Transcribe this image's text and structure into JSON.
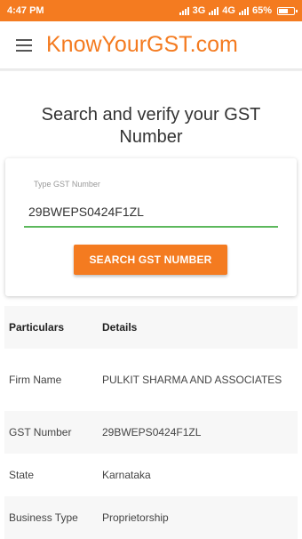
{
  "status_bar": {
    "time": "4:47 PM",
    "network_1": "3G",
    "network_2": "4G",
    "battery": "65%",
    "battery_level": 0.65
  },
  "app_bar": {
    "title": "KnowYourGST.com"
  },
  "heading": "Search and verify your GST Number",
  "search": {
    "label": "Type GST Number",
    "value": "29BWEPS0424F1ZL",
    "button_label": "SEARCH GST NUMBER"
  },
  "details": {
    "header": {
      "particulars": "Particulars",
      "details": "Details"
    },
    "rows": [
      {
        "label": "Firm Name",
        "value": "PULKIT SHARMA AND ASSOCIATES"
      },
      {
        "label": "GST Number",
        "value": "29BWEPS0424F1ZL"
      },
      {
        "label": "State",
        "value": "Karnataka"
      },
      {
        "label": "Business Type",
        "value": "Proprietorship"
      }
    ]
  },
  "colors": {
    "accent": "#F47B20",
    "input_underline": "#5CB85C"
  }
}
